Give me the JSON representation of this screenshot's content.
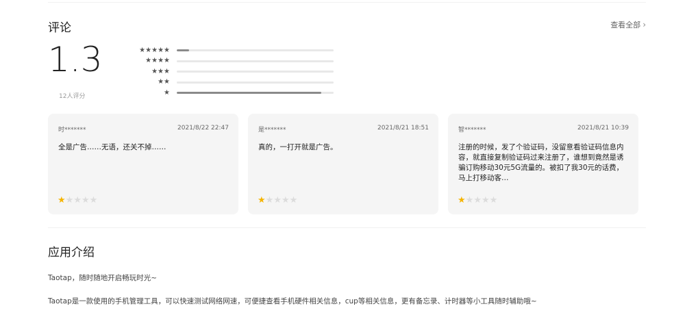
{
  "reviews_section": {
    "title": "评论",
    "view_all": "查看全部",
    "score": "1.3",
    "rating_count": "12人评分",
    "distribution": [
      {
        "stars": "★★★★★",
        "fraction": 0.08
      },
      {
        "stars": "★★★★",
        "fraction": 0.0
      },
      {
        "stars": "★★★",
        "fraction": 0.0
      },
      {
        "stars": "★★",
        "fraction": 0.0
      },
      {
        "stars": "★",
        "fraction": 0.92
      }
    ],
    "cards": [
      {
        "user": "时*******",
        "date": "2021/8/22 22:47",
        "text": "全是广告……无语，还关不掉……",
        "rating": 1
      },
      {
        "user": "是*******",
        "date": "2021/8/21 18:51",
        "text": "真的，一打开就是广告。",
        "rating": 1
      },
      {
        "user": "智*******",
        "date": "2021/8/21 10:39",
        "text": "注册的时候，发了个验证码，没留意看验证码信息内容，就直接复制验证码过来注册了，谁想到竟然是诱骗订购移动30元5G流量的。被扣了我30元的话费，马上打移动客…",
        "rating": 1
      }
    ]
  },
  "intro_section": {
    "title": "应用介绍",
    "line1": "Taotap，随时随地开启畅玩时光~",
    "line2": "Taotap是一款使用的手机管理工具，可以快速测试网络网速，可便捷查看手机硬件相关信息，cup等相关信息，更有备忘录、计时器等小工具随时辅助哦~"
  },
  "colors": {
    "star_on": "#f5b400",
    "star_off": "#dcdcdc",
    "bar_fill": "#8a8a8a",
    "card_bg": "#f5f5f5"
  }
}
